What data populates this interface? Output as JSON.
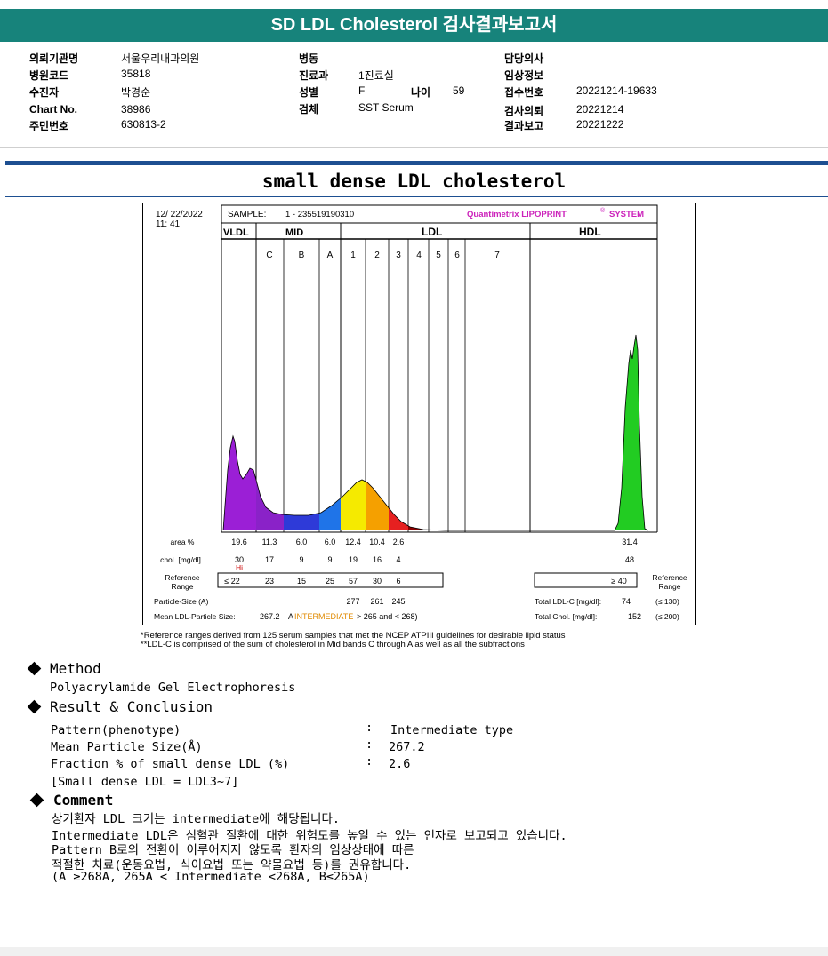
{
  "header": {
    "title": "SD LDL Cholesterol 검사결과보고서",
    "col1": [
      {
        "k": "의뢰기관명",
        "v": "서울우리내과의원"
      },
      {
        "k": "병원코드",
        "v": "35818"
      },
      {
        "k": "수진자",
        "v": "박경순"
      },
      {
        "k": "Chart No.",
        "v": "38986"
      },
      {
        "k": "주민번호",
        "v": "630813-2"
      }
    ],
    "col2": [
      {
        "k": "병동",
        "v": ""
      },
      {
        "k": "진료과",
        "v": "1진료실"
      },
      {
        "k": "성별",
        "v": "F"
      },
      {
        "k": "검체",
        "v": "SST Serum"
      }
    ],
    "age_label": "나이",
    "age_value": "59",
    "col3": [
      {
        "k": "담당의사",
        "v": ""
      },
      {
        "k": "임상정보",
        "v": ""
      },
      {
        "k": "접수번호",
        "v": "20221214-19633"
      },
      {
        "k": "검사의뢰",
        "v": "20221214"
      },
      {
        "k": "결과보고",
        "v": "20221222"
      }
    ]
  },
  "report_title": "small dense LDL cholesterol",
  "lipoprint": {
    "date": "12/ 22/2022",
    "time": "11: 41",
    "sample_label": "SAMPLE:",
    "sample_id": "1 - 235519190310",
    "brand": "Quantimetrix LIPOPRINT",
    "brand_mark": "®",
    "brand_suffix": "SYSTEM",
    "group_labels": [
      "VLDL",
      "MID",
      "LDL",
      "HDL"
    ],
    "band_labels": [
      "C",
      "B",
      "A",
      "1",
      "2",
      "3",
      "4",
      "5",
      "6",
      "7"
    ],
    "row_labels": {
      "area": "area %",
      "chol": "chol. [mg/dl]",
      "ref1": "Reference",
      "ref2": "Range",
      "particle": "Particle-Size (A)",
      "mean": "Mean LDL-Particle Size:"
    },
    "area_values": [
      "19.6",
      "11.3",
      "6.0",
      "6.0",
      "12.4",
      "10.4",
      "2.6"
    ],
    "hdl_area": "31.4",
    "chol_values": [
      "30",
      "17",
      "9",
      "9",
      "19",
      "16",
      "4"
    ],
    "hdl_chol": "48",
    "hi_flag": "Hi",
    "ref_values": [
      "≤ 22",
      "23",
      "15",
      "25",
      "57",
      "30",
      "6"
    ],
    "hdl_ref": "≥ 40",
    "particle_sizes": [
      "277",
      "261",
      "245"
    ],
    "mean_size": "267.2",
    "mean_unit": "A",
    "mean_class": "INTERMEDIATE",
    "mean_range": "> 265 and < 268)",
    "total_ldl_label": "Total LDL-C [mg/dl]:",
    "total_ldl_value": "74",
    "total_ldl_ref": "(≤ 130)",
    "total_chol_label": "Total Chol. [mg/dl]:",
    "total_chol_value": "152",
    "total_chol_ref": "(≤ 200)",
    "footnote1": "*Reference ranges derived from 125 serum samples that met the NCEP ATPIII guidelines for desirable lipid status",
    "footnote2": "**LDL-C is comprised of the sum of cholesterol in Mid bands C through A as well as all the subfractions"
  },
  "method": {
    "title": "Method",
    "text": "Polyacrylamide Gel Electrophoresis"
  },
  "result": {
    "title": "Result & Conclusion",
    "rows": [
      {
        "label": "Pattern(phenotype)",
        "sep": ":",
        "value": "Intermediate type"
      },
      {
        "label": "Mean Particle Size(Å)",
        "sep": ":",
        "value": "267.2"
      },
      {
        "label": "Fraction % of small dense LDL (%)",
        "sep": ":",
        "value": "2.6"
      }
    ],
    "note": "[Small dense LDL = LDL3~7]"
  },
  "comment": {
    "title": "Comment",
    "lines": [
      "상기환자 LDL 크기는 intermediate에 해당됩니다.",
      "Intermediate LDL은 심혈관 질환에 대한 위험도를 높일 수 있는 인자로 보고되고 있습니다.",
      "Pattern B로의 전환이 이루어지지 않도록 환자의 임상상태에 따른",
      "적절한 치료(운동요법, 식이요법 또는 약물요법 등)를 권유합니다.",
      "(A ≥268A, 265A < Intermediate <268A, B≤265A)"
    ]
  },
  "colors": {
    "title_bar": "#17837b",
    "rule_blue": "#1d4f91",
    "brand_magenta": "#cc22bb",
    "hi_red": "#cc0000",
    "intermediate_orange": "#e08a00",
    "band_colors": [
      "#9b1fd6",
      "#b51fd6",
      "#2e3ad8",
      "#1f74e8",
      "#f5ea00",
      "#f5a000",
      "#e62020",
      "#8a0000",
      "#0000cc",
      "#22cc22"
    ]
  }
}
